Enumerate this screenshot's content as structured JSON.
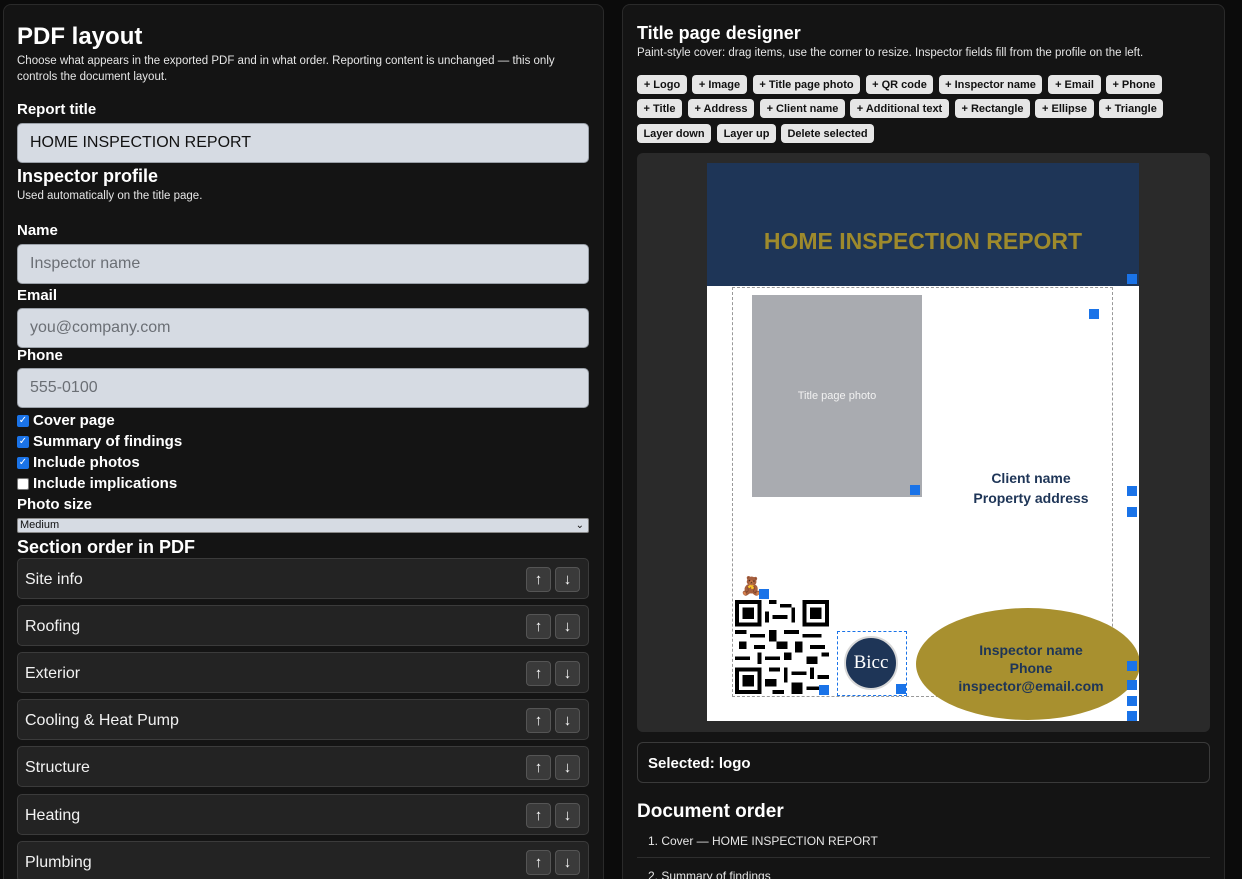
{
  "left": {
    "title": "PDF layout",
    "description": "Choose what appears in the exported PDF and in what order. Reporting content is unchanged — this only controls the document layout.",
    "report_title_label": "Report title",
    "report_title_value": "HOME INSPECTION REPORT",
    "inspector_heading": "Inspector profile",
    "inspector_sub": "Used automatically on the title page.",
    "name_label": "Name",
    "name_placeholder": "Inspector name",
    "email_label": "Email",
    "email_placeholder": "you@company.com",
    "phone_label": "Phone",
    "phone_placeholder": "555-0100",
    "checkboxes": [
      {
        "label": "Cover page",
        "checked": true
      },
      {
        "label": "Summary of findings",
        "checked": true
      },
      {
        "label": "Include photos",
        "checked": true
      },
      {
        "label": "Include implications",
        "checked": false
      }
    ],
    "photo_size_label": "Photo size",
    "photo_size_value": "Medium",
    "section_order_heading": "Section order in PDF",
    "sections": [
      "Site info",
      "Roofing",
      "Exterior",
      "Cooling & Heat Pump",
      "Structure",
      "Heating",
      "Plumbing"
    ],
    "up_glyph": "↑",
    "down_glyph": "↓"
  },
  "right": {
    "title": "Title page designer",
    "description": "Paint-style cover: drag items, use the corner to resize. Inspector fields fill from the profile on the left.",
    "toolbar": [
      "+ Logo",
      "+ Image",
      "+ Title page photo",
      "+ QR code",
      "+ Inspector name",
      "+ Email",
      "+ Phone",
      "+ Title",
      "+ Address",
      "+ Client name",
      "+ Additional text",
      "+ Rectangle",
      "+ Ellipse",
      "+ Triangle",
      "Layer down",
      "Layer up",
      "Delete selected"
    ],
    "canvas": {
      "banner_title": "HOME INSPECTION REPORT",
      "photo_label": "Title page photo",
      "client_name": "Client name",
      "property_address": "Property address",
      "inspector_name": "Inspector name",
      "inspector_phone": "Phone",
      "inspector_email": "inspector@email.com",
      "logo_text": "Bicc",
      "banner_color": "#1e3557",
      "accent_color": "#a8902f"
    },
    "selected_text": "Selected: logo",
    "document_order_heading": "Document order",
    "document_order": [
      "1. Cover — HOME INSPECTION REPORT",
      "2. Summary of findings"
    ]
  }
}
